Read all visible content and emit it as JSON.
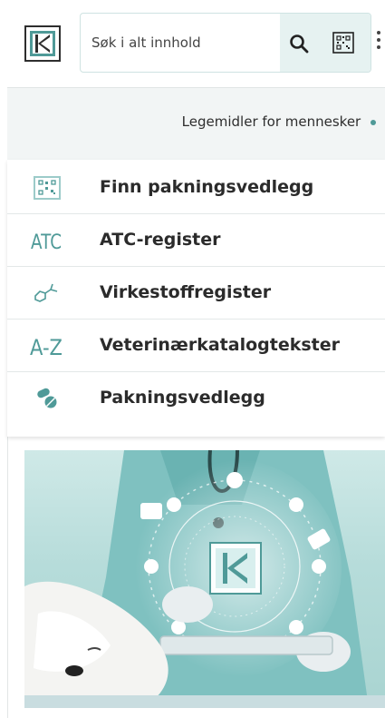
{
  "header": {
    "logo_icon": "felleskatalogen-logo-icon",
    "search": {
      "placeholder": "Søk i alt innhold",
      "search_icon": "search-icon",
      "scan_icon": "barcode-scan-icon"
    },
    "more_icon": "vertical-dots-icon"
  },
  "lang_selector": {
    "label": "Legemidler for mennesker"
  },
  "menu": {
    "items": [
      {
        "label": "Finn pakningsvedlegg",
        "icon": "barcode-scan-icon"
      },
      {
        "label": "ATC-register",
        "icon": "atc-icon"
      },
      {
        "label": "Virkestoffregister",
        "icon": "molecule-icon"
      },
      {
        "label": "Veterinærkatalogtekster",
        "icon": "a-z-icon"
      },
      {
        "label": "Pakningsvedlegg",
        "icon": "pills-icon"
      }
    ]
  },
  "hero": {
    "alt_icon": "veterinarian-dog-illustration"
  },
  "colors": {
    "accent": "#4f9a98",
    "strip_bg": "#f2f5f5",
    "search_btn_bg": "#e6f2f1"
  }
}
